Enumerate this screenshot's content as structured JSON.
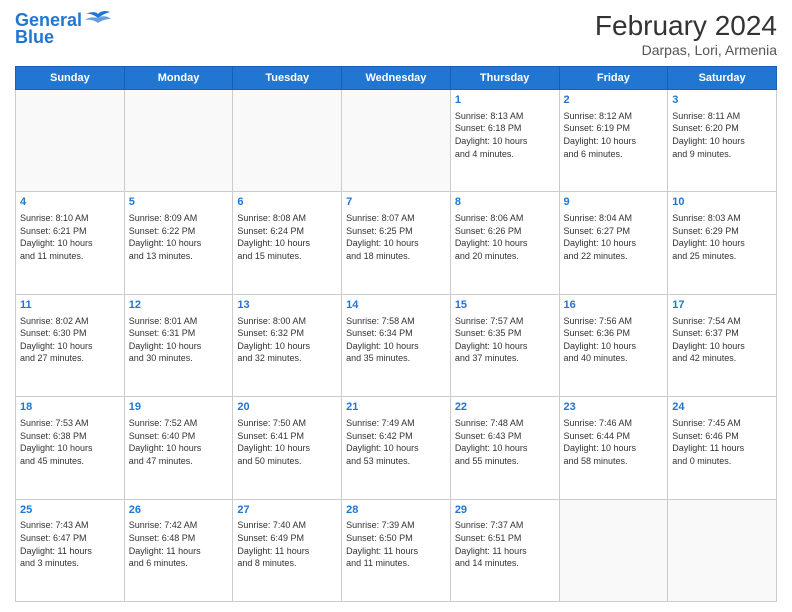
{
  "header": {
    "logo_line1": "General",
    "logo_line2": "Blue",
    "title": "February 2024",
    "subtitle": "Darpas, Lori, Armenia"
  },
  "days_of_week": [
    "Sunday",
    "Monday",
    "Tuesday",
    "Wednesday",
    "Thursday",
    "Friday",
    "Saturday"
  ],
  "weeks": [
    [
      {
        "day": "",
        "info": ""
      },
      {
        "day": "",
        "info": ""
      },
      {
        "day": "",
        "info": ""
      },
      {
        "day": "",
        "info": ""
      },
      {
        "day": "1",
        "info": "Sunrise: 8:13 AM\nSunset: 6:18 PM\nDaylight: 10 hours\nand 4 minutes."
      },
      {
        "day": "2",
        "info": "Sunrise: 8:12 AM\nSunset: 6:19 PM\nDaylight: 10 hours\nand 6 minutes."
      },
      {
        "day": "3",
        "info": "Sunrise: 8:11 AM\nSunset: 6:20 PM\nDaylight: 10 hours\nand 9 minutes."
      }
    ],
    [
      {
        "day": "4",
        "info": "Sunrise: 8:10 AM\nSunset: 6:21 PM\nDaylight: 10 hours\nand 11 minutes."
      },
      {
        "day": "5",
        "info": "Sunrise: 8:09 AM\nSunset: 6:22 PM\nDaylight: 10 hours\nand 13 minutes."
      },
      {
        "day": "6",
        "info": "Sunrise: 8:08 AM\nSunset: 6:24 PM\nDaylight: 10 hours\nand 15 minutes."
      },
      {
        "day": "7",
        "info": "Sunrise: 8:07 AM\nSunset: 6:25 PM\nDaylight: 10 hours\nand 18 minutes."
      },
      {
        "day": "8",
        "info": "Sunrise: 8:06 AM\nSunset: 6:26 PM\nDaylight: 10 hours\nand 20 minutes."
      },
      {
        "day": "9",
        "info": "Sunrise: 8:04 AM\nSunset: 6:27 PM\nDaylight: 10 hours\nand 22 minutes."
      },
      {
        "day": "10",
        "info": "Sunrise: 8:03 AM\nSunset: 6:29 PM\nDaylight: 10 hours\nand 25 minutes."
      }
    ],
    [
      {
        "day": "11",
        "info": "Sunrise: 8:02 AM\nSunset: 6:30 PM\nDaylight: 10 hours\nand 27 minutes."
      },
      {
        "day": "12",
        "info": "Sunrise: 8:01 AM\nSunset: 6:31 PM\nDaylight: 10 hours\nand 30 minutes."
      },
      {
        "day": "13",
        "info": "Sunrise: 8:00 AM\nSunset: 6:32 PM\nDaylight: 10 hours\nand 32 minutes."
      },
      {
        "day": "14",
        "info": "Sunrise: 7:58 AM\nSunset: 6:34 PM\nDaylight: 10 hours\nand 35 minutes."
      },
      {
        "day": "15",
        "info": "Sunrise: 7:57 AM\nSunset: 6:35 PM\nDaylight: 10 hours\nand 37 minutes."
      },
      {
        "day": "16",
        "info": "Sunrise: 7:56 AM\nSunset: 6:36 PM\nDaylight: 10 hours\nand 40 minutes."
      },
      {
        "day": "17",
        "info": "Sunrise: 7:54 AM\nSunset: 6:37 PM\nDaylight: 10 hours\nand 42 minutes."
      }
    ],
    [
      {
        "day": "18",
        "info": "Sunrise: 7:53 AM\nSunset: 6:38 PM\nDaylight: 10 hours\nand 45 minutes."
      },
      {
        "day": "19",
        "info": "Sunrise: 7:52 AM\nSunset: 6:40 PM\nDaylight: 10 hours\nand 47 minutes."
      },
      {
        "day": "20",
        "info": "Sunrise: 7:50 AM\nSunset: 6:41 PM\nDaylight: 10 hours\nand 50 minutes."
      },
      {
        "day": "21",
        "info": "Sunrise: 7:49 AM\nSunset: 6:42 PM\nDaylight: 10 hours\nand 53 minutes."
      },
      {
        "day": "22",
        "info": "Sunrise: 7:48 AM\nSunset: 6:43 PM\nDaylight: 10 hours\nand 55 minutes."
      },
      {
        "day": "23",
        "info": "Sunrise: 7:46 AM\nSunset: 6:44 PM\nDaylight: 10 hours\nand 58 minutes."
      },
      {
        "day": "24",
        "info": "Sunrise: 7:45 AM\nSunset: 6:46 PM\nDaylight: 11 hours\nand 0 minutes."
      }
    ],
    [
      {
        "day": "25",
        "info": "Sunrise: 7:43 AM\nSunset: 6:47 PM\nDaylight: 11 hours\nand 3 minutes."
      },
      {
        "day": "26",
        "info": "Sunrise: 7:42 AM\nSunset: 6:48 PM\nDaylight: 11 hours\nand 6 minutes."
      },
      {
        "day": "27",
        "info": "Sunrise: 7:40 AM\nSunset: 6:49 PM\nDaylight: 11 hours\nand 8 minutes."
      },
      {
        "day": "28",
        "info": "Sunrise: 7:39 AM\nSunset: 6:50 PM\nDaylight: 11 hours\nand 11 minutes."
      },
      {
        "day": "29",
        "info": "Sunrise: 7:37 AM\nSunset: 6:51 PM\nDaylight: 11 hours\nand 14 minutes."
      },
      {
        "day": "",
        "info": ""
      },
      {
        "day": "",
        "info": ""
      }
    ]
  ]
}
